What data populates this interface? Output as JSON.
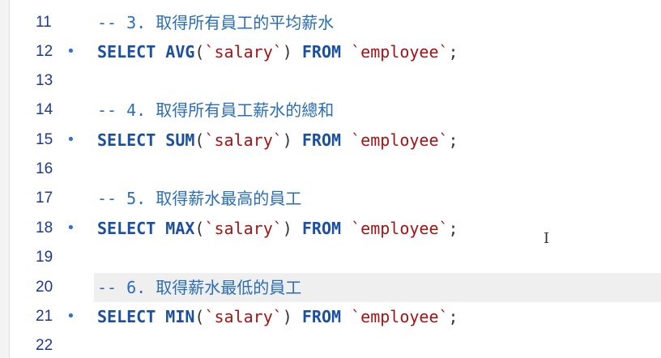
{
  "editor": {
    "lines": [
      {
        "num": "11",
        "dot": false,
        "comment": "-- 3. 取得所有員工的平均薪水"
      },
      {
        "num": "12",
        "dot": true,
        "select": "SELECT",
        "func": "AVG",
        "open": "(",
        "col": "`salary`",
        "close": ")",
        "from": "FROM",
        "table": "`employee`",
        "semi": ";"
      },
      {
        "num": "13",
        "dot": false
      },
      {
        "num": "14",
        "dot": false,
        "comment": "-- 4. 取得所有員工薪水的總和"
      },
      {
        "num": "15",
        "dot": true,
        "select": "SELECT",
        "func": "SUM",
        "open": "(",
        "col": "`salary`",
        "close": ")",
        "from": "FROM",
        "table": "`employee`",
        "semi": ";"
      },
      {
        "num": "16",
        "dot": false
      },
      {
        "num": "17",
        "dot": false,
        "comment": "-- 5. 取得薪水最高的員工"
      },
      {
        "num": "18",
        "dot": true,
        "select": "SELECT",
        "func": "MAX",
        "open": "(",
        "col": "`salary`",
        "close": ")",
        "from": "FROM",
        "table": "`employee`",
        "semi": ";"
      },
      {
        "num": "19",
        "dot": false
      },
      {
        "num": "20",
        "dot": false,
        "comment": "-- 6. 取得薪水最低的員工"
      },
      {
        "num": "21",
        "dot": true,
        "select": "SELECT",
        "func": "MIN",
        "open": "(",
        "col": "`salary`",
        "close": ")",
        "from": "FROM",
        "table": "`employee`",
        "semi": ";"
      },
      {
        "num": "22",
        "dot": false
      }
    ],
    "dot_glyph": "•",
    "cursor_glyph": "I"
  },
  "colors": {
    "keyword": "#1b4fa0",
    "string": "#a31515",
    "comment": "#2a6db8",
    "line_number": "#1e3a8a",
    "current_line_bg": "#efefef"
  }
}
